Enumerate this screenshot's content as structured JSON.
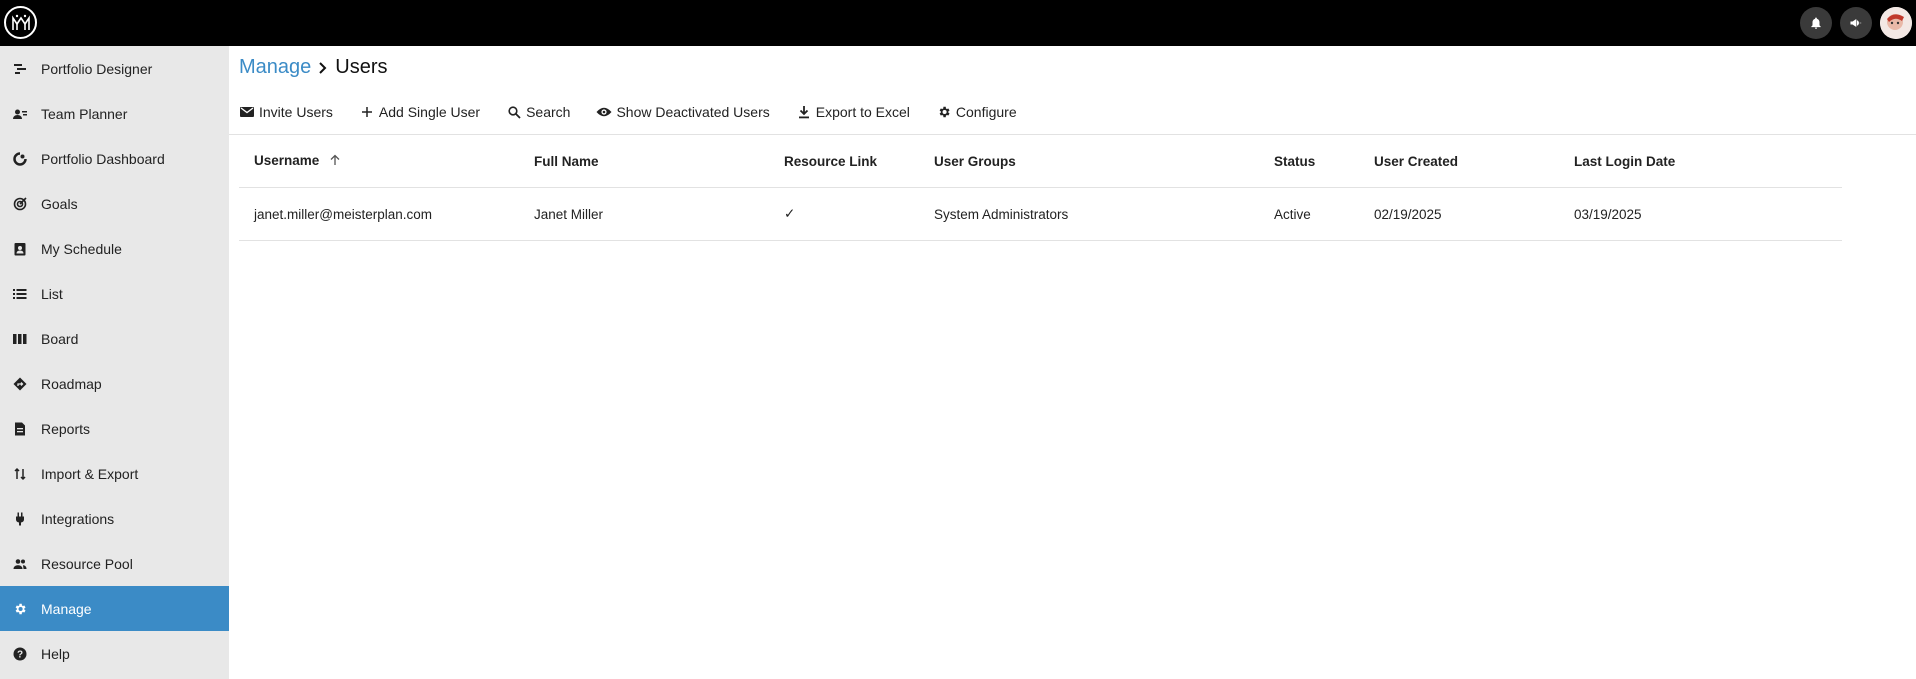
{
  "topbar": {
    "logo_icon": "meisterplan-logo",
    "buttons": [
      "bell-icon",
      "megaphone-icon"
    ],
    "avatar_icon": "avatar"
  },
  "sidebar": {
    "items": [
      {
        "label": "Portfolio Designer",
        "icon": "portfolio-designer-icon"
      },
      {
        "label": "Team Planner",
        "icon": "team-planner-icon"
      },
      {
        "label": "Portfolio Dashboard",
        "icon": "dashboard-icon"
      },
      {
        "label": "Goals",
        "icon": "goals-icon"
      },
      {
        "label": "My Schedule",
        "icon": "schedule-icon"
      },
      {
        "label": "List",
        "icon": "list-icon"
      },
      {
        "label": "Board",
        "icon": "board-icon"
      },
      {
        "label": "Roadmap",
        "icon": "roadmap-icon"
      },
      {
        "label": "Reports",
        "icon": "reports-icon"
      },
      {
        "label": "Import & Export",
        "icon": "import-export-icon"
      },
      {
        "label": "Integrations",
        "icon": "plug-icon"
      },
      {
        "label": "Resource Pool",
        "icon": "people-icon"
      },
      {
        "label": "Manage",
        "icon": "gear-icon",
        "active": true
      },
      {
        "label": "Help",
        "icon": "help-icon"
      }
    ],
    "active_color": "#3b8bc6"
  },
  "breadcrumb": {
    "parent": "Manage",
    "current": "Users"
  },
  "toolbar": {
    "invite": "Invite Users",
    "add_single": "Add Single User",
    "search": "Search",
    "show_deactivated": "Show Deactivated Users",
    "export": "Export to Excel",
    "configure": "Configure"
  },
  "table": {
    "headers": [
      "Username",
      "Full Name",
      "Resource Link",
      "User Groups",
      "Status",
      "User Created",
      "Last Login Date"
    ],
    "sort_column": "Username",
    "rows": [
      {
        "username": "janet.miller@meisterplan.com",
        "full_name": "Janet Miller",
        "resource_link": "✓",
        "user_groups": "System Administrators",
        "status": "Active",
        "user_created": "02/19/2025",
        "last_login": "03/19/2025"
      }
    ]
  }
}
